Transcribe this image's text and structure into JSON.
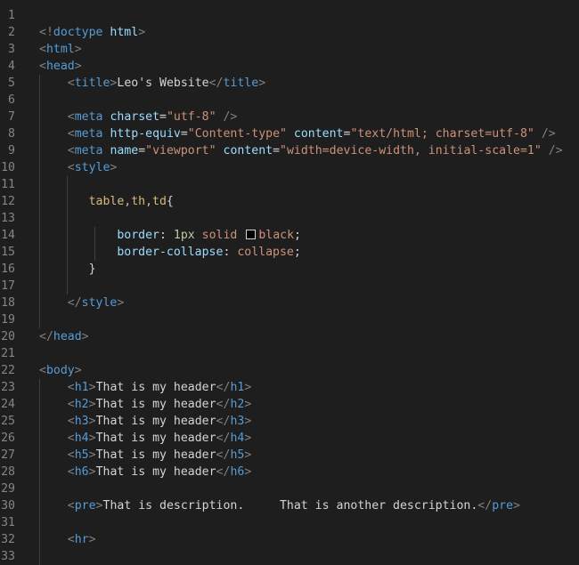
{
  "editor": {
    "theme_colors": {
      "background": "#1e1e1e",
      "line_number": "#858585",
      "punctuation": "#808080",
      "tag": "#569cd6",
      "attribute": "#9cdcfe",
      "string": "#ce9178",
      "text": "#d4d4d4",
      "selector": "#d7ba7d",
      "number": "#b5cea8"
    },
    "lines": [
      {
        "n": "1",
        "tokens": []
      },
      {
        "n": "2",
        "tokens": [
          {
            "t": "<!",
            "c": "t-punc"
          },
          {
            "t": "doctype",
            "c": "t-tag"
          },
          {
            "t": " ",
            "c": "t-text"
          },
          {
            "t": "html",
            "c": "t-attr"
          },
          {
            "t": ">",
            "c": "t-punc"
          }
        ]
      },
      {
        "n": "3",
        "tokens": [
          {
            "t": "<",
            "c": "t-punc"
          },
          {
            "t": "html",
            "c": "t-tag"
          },
          {
            "t": ">",
            "c": "t-punc"
          }
        ]
      },
      {
        "n": "4",
        "tokens": [
          {
            "t": "<",
            "c": "t-punc"
          },
          {
            "t": "head",
            "c": "t-tag"
          },
          {
            "t": ">",
            "c": "t-punc"
          }
        ]
      },
      {
        "n": "5",
        "tokens": [
          {
            "t": "    ",
            "c": "t-text"
          },
          {
            "t": "<",
            "c": "t-punc"
          },
          {
            "t": "title",
            "c": "t-tag"
          },
          {
            "t": ">",
            "c": "t-punc"
          },
          {
            "t": "Leo's Website",
            "c": "t-text"
          },
          {
            "t": "</",
            "c": "t-punc"
          },
          {
            "t": "title",
            "c": "t-tag"
          },
          {
            "t": ">",
            "c": "t-punc"
          }
        ]
      },
      {
        "n": "6",
        "tokens": []
      },
      {
        "n": "7",
        "tokens": [
          {
            "t": "    ",
            "c": "t-text"
          },
          {
            "t": "<",
            "c": "t-punc"
          },
          {
            "t": "meta",
            "c": "t-tag"
          },
          {
            "t": " ",
            "c": "t-text"
          },
          {
            "t": "charset",
            "c": "t-attr"
          },
          {
            "t": "=",
            "c": "t-text"
          },
          {
            "t": "\"utf-8\"",
            "c": "t-str"
          },
          {
            "t": " />",
            "c": "t-punc"
          }
        ]
      },
      {
        "n": "8",
        "tokens": [
          {
            "t": "    ",
            "c": "t-text"
          },
          {
            "t": "<",
            "c": "t-punc"
          },
          {
            "t": "meta",
            "c": "t-tag"
          },
          {
            "t": " ",
            "c": "t-text"
          },
          {
            "t": "http-equiv",
            "c": "t-attr"
          },
          {
            "t": "=",
            "c": "t-text"
          },
          {
            "t": "\"Content-type\"",
            "c": "t-str"
          },
          {
            "t": " ",
            "c": "t-text"
          },
          {
            "t": "content",
            "c": "t-attr"
          },
          {
            "t": "=",
            "c": "t-text"
          },
          {
            "t": "\"text/html; charset=utf-8\"",
            "c": "t-str"
          },
          {
            "t": " />",
            "c": "t-punc"
          }
        ]
      },
      {
        "n": "9",
        "tokens": [
          {
            "t": "    ",
            "c": "t-text"
          },
          {
            "t": "<",
            "c": "t-punc"
          },
          {
            "t": "meta",
            "c": "t-tag"
          },
          {
            "t": " ",
            "c": "t-text"
          },
          {
            "t": "name",
            "c": "t-attr"
          },
          {
            "t": "=",
            "c": "t-text"
          },
          {
            "t": "\"viewport\"",
            "c": "t-str"
          },
          {
            "t": " ",
            "c": "t-text"
          },
          {
            "t": "content",
            "c": "t-attr"
          },
          {
            "t": "=",
            "c": "t-text"
          },
          {
            "t": "\"width=device-width, initial-scale=1\"",
            "c": "t-str"
          },
          {
            "t": " />",
            "c": "t-punc"
          }
        ]
      },
      {
        "n": "10",
        "tokens": [
          {
            "t": "    ",
            "c": "t-text"
          },
          {
            "t": "<",
            "c": "t-punc"
          },
          {
            "t": "style",
            "c": "t-tag"
          },
          {
            "t": ">",
            "c": "t-punc"
          }
        ]
      },
      {
        "n": "11",
        "tokens": []
      },
      {
        "n": "12",
        "tokens": [
          {
            "t": "       ",
            "c": "t-text"
          },
          {
            "t": "table,th,td",
            "c": "t-sel"
          },
          {
            "t": "{",
            "c": "t-text"
          }
        ]
      },
      {
        "n": "13",
        "tokens": []
      },
      {
        "n": "14",
        "tokens": [
          {
            "t": "           ",
            "c": "t-text"
          },
          {
            "t": "border",
            "c": "t-prop"
          },
          {
            "t": ": ",
            "c": "t-text"
          },
          {
            "t": "1px",
            "c": "t-num"
          },
          {
            "t": " ",
            "c": "t-text"
          },
          {
            "t": "solid",
            "c": "t-val"
          },
          {
            "t": " ",
            "c": "t-text"
          },
          {
            "swatch": true
          },
          {
            "t": "black",
            "c": "t-val"
          },
          {
            "t": ";",
            "c": "t-text"
          }
        ]
      },
      {
        "n": "15",
        "tokens": [
          {
            "t": "           ",
            "c": "t-text"
          },
          {
            "t": "border-collapse",
            "c": "t-prop"
          },
          {
            "t": ": ",
            "c": "t-text"
          },
          {
            "t": "collapse",
            "c": "t-val"
          },
          {
            "t": ";",
            "c": "t-text"
          }
        ]
      },
      {
        "n": "16",
        "tokens": [
          {
            "t": "       ",
            "c": "t-text"
          },
          {
            "t": "}",
            "c": "t-text"
          }
        ]
      },
      {
        "n": "17",
        "tokens": []
      },
      {
        "n": "18",
        "tokens": [
          {
            "t": "    ",
            "c": "t-text"
          },
          {
            "t": "</",
            "c": "t-punc"
          },
          {
            "t": "style",
            "c": "t-tag"
          },
          {
            "t": ">",
            "c": "t-punc"
          }
        ]
      },
      {
        "n": "19",
        "tokens": []
      },
      {
        "n": "20",
        "tokens": [
          {
            "t": "</",
            "c": "t-punc"
          },
          {
            "t": "head",
            "c": "t-tag"
          },
          {
            "t": ">",
            "c": "t-punc"
          }
        ]
      },
      {
        "n": "21",
        "tokens": []
      },
      {
        "n": "22",
        "tokens": [
          {
            "t": "<",
            "c": "t-punc"
          },
          {
            "t": "body",
            "c": "t-tag"
          },
          {
            "t": ">",
            "c": "t-punc"
          }
        ]
      },
      {
        "n": "23",
        "tokens": [
          {
            "t": "    ",
            "c": "t-text"
          },
          {
            "t": "<",
            "c": "t-punc"
          },
          {
            "t": "h1",
            "c": "t-tag"
          },
          {
            "t": ">",
            "c": "t-punc"
          },
          {
            "t": "That is my header",
            "c": "t-text"
          },
          {
            "t": "</",
            "c": "t-punc"
          },
          {
            "t": "h1",
            "c": "t-tag"
          },
          {
            "t": ">",
            "c": "t-punc"
          }
        ]
      },
      {
        "n": "24",
        "tokens": [
          {
            "t": "    ",
            "c": "t-text"
          },
          {
            "t": "<",
            "c": "t-punc"
          },
          {
            "t": "h2",
            "c": "t-tag"
          },
          {
            "t": ">",
            "c": "t-punc"
          },
          {
            "t": "That is my header",
            "c": "t-text"
          },
          {
            "t": "</",
            "c": "t-punc"
          },
          {
            "t": "h2",
            "c": "t-tag"
          },
          {
            "t": ">",
            "c": "t-punc"
          }
        ]
      },
      {
        "n": "25",
        "tokens": [
          {
            "t": "    ",
            "c": "t-text"
          },
          {
            "t": "<",
            "c": "t-punc"
          },
          {
            "t": "h3",
            "c": "t-tag"
          },
          {
            "t": ">",
            "c": "t-punc"
          },
          {
            "t": "That is my header",
            "c": "t-text"
          },
          {
            "t": "</",
            "c": "t-punc"
          },
          {
            "t": "h3",
            "c": "t-tag"
          },
          {
            "t": ">",
            "c": "t-punc"
          }
        ]
      },
      {
        "n": "26",
        "tokens": [
          {
            "t": "    ",
            "c": "t-text"
          },
          {
            "t": "<",
            "c": "t-punc"
          },
          {
            "t": "h4",
            "c": "t-tag"
          },
          {
            "t": ">",
            "c": "t-punc"
          },
          {
            "t": "That is my header",
            "c": "t-text"
          },
          {
            "t": "</",
            "c": "t-punc"
          },
          {
            "t": "h4",
            "c": "t-tag"
          },
          {
            "t": ">",
            "c": "t-punc"
          }
        ]
      },
      {
        "n": "27",
        "tokens": [
          {
            "t": "    ",
            "c": "t-text"
          },
          {
            "t": "<",
            "c": "t-punc"
          },
          {
            "t": "h5",
            "c": "t-tag"
          },
          {
            "t": ">",
            "c": "t-punc"
          },
          {
            "t": "That is my header",
            "c": "t-text"
          },
          {
            "t": "</",
            "c": "t-punc"
          },
          {
            "t": "h5",
            "c": "t-tag"
          },
          {
            "t": ">",
            "c": "t-punc"
          }
        ]
      },
      {
        "n": "28",
        "tokens": [
          {
            "t": "    ",
            "c": "t-text"
          },
          {
            "t": "<",
            "c": "t-punc"
          },
          {
            "t": "h6",
            "c": "t-tag"
          },
          {
            "t": ">",
            "c": "t-punc"
          },
          {
            "t": "That is my header",
            "c": "t-text"
          },
          {
            "t": "</",
            "c": "t-punc"
          },
          {
            "t": "h6",
            "c": "t-tag"
          },
          {
            "t": ">",
            "c": "t-punc"
          }
        ]
      },
      {
        "n": "29",
        "tokens": []
      },
      {
        "n": "30",
        "tokens": [
          {
            "t": "    ",
            "c": "t-text"
          },
          {
            "t": "<",
            "c": "t-punc"
          },
          {
            "t": "pre",
            "c": "t-tag"
          },
          {
            "t": ">",
            "c": "t-punc"
          },
          {
            "t": "That is description.     That is another description.",
            "c": "t-text"
          },
          {
            "t": "</",
            "c": "t-punc"
          },
          {
            "t": "pre",
            "c": "t-tag"
          },
          {
            "t": ">",
            "c": "t-punc"
          }
        ]
      },
      {
        "n": "31",
        "tokens": []
      },
      {
        "n": "32",
        "tokens": [
          {
            "t": "    ",
            "c": "t-text"
          },
          {
            "t": "<",
            "c": "t-punc"
          },
          {
            "t": "hr",
            "c": "t-tag"
          },
          {
            "t": ">",
            "c": "t-punc"
          }
        ]
      },
      {
        "n": "33",
        "tokens": []
      }
    ]
  }
}
